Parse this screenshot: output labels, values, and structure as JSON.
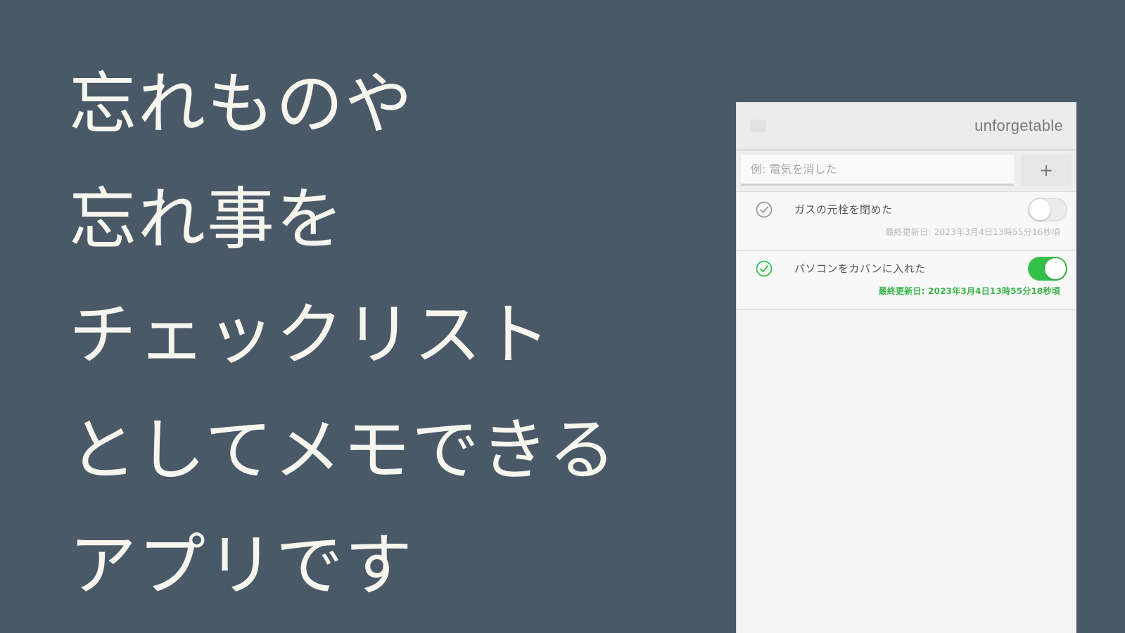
{
  "headline": {
    "lines": [
      "忘れものや",
      "忘れ事を",
      "チェックリスト",
      "としてメモできる",
      "アプリです"
    ]
  },
  "app": {
    "title": "unforgetable",
    "input": {
      "placeholder": "例: 電気を消した",
      "value": ""
    },
    "add_button_label": "+",
    "tasks": [
      {
        "label": "ガスの元栓を閉めた",
        "timestamp": "最終更新日: 2023年3月4日13時55分16秒頃",
        "checked": false
      },
      {
        "label": "パソコンをカバンに入れた",
        "timestamp": "最終更新日: 2023年3月4日13時55分18秒頃",
        "checked": true
      }
    ]
  },
  "colors": {
    "background": "#4a5968",
    "headline_text": "#f7f6ee",
    "accent_green": "#34c048",
    "muted_gray": "#a8a8a8"
  },
  "icons": {
    "check": "check-circle-icon",
    "menu": "menu-icon"
  }
}
